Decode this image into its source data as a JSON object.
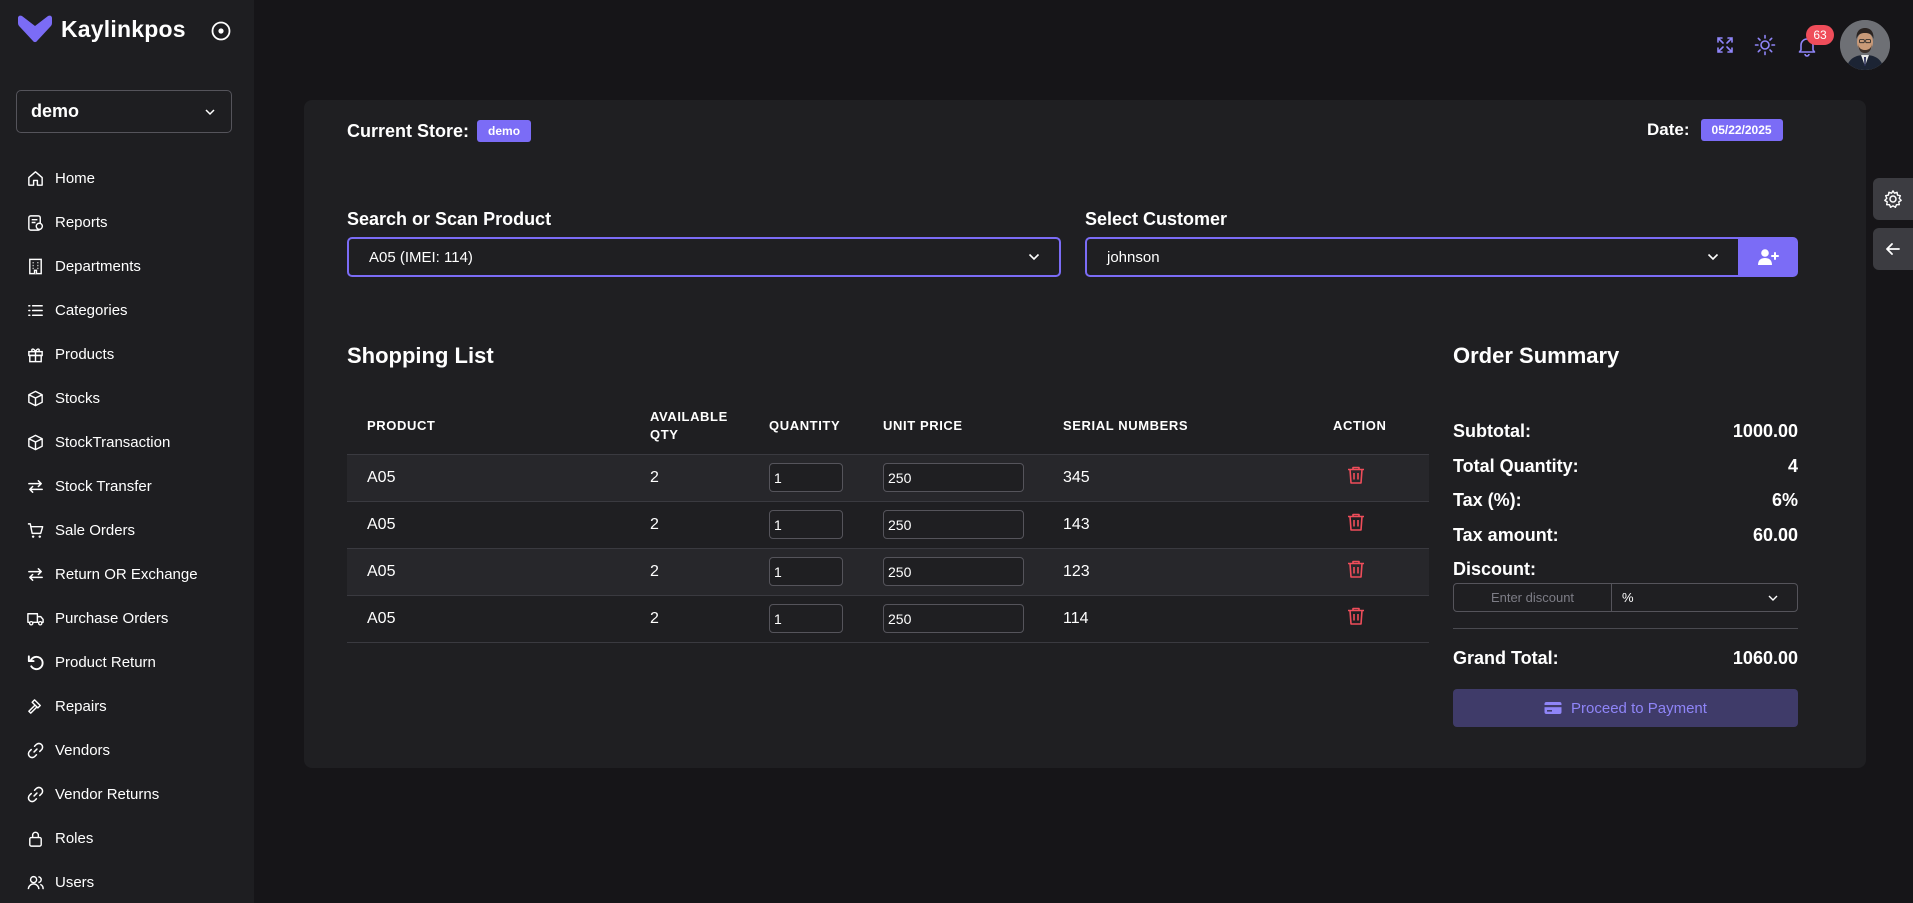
{
  "app": {
    "name": "Kaylinkpos"
  },
  "store_selector": {
    "value": "demo"
  },
  "sidebar": {
    "items": [
      {
        "label": "Home",
        "icon": "home-icon"
      },
      {
        "label": "Reports",
        "icon": "reports-icon"
      },
      {
        "label": "Departments",
        "icon": "building-icon"
      },
      {
        "label": "Categories",
        "icon": "list-icon"
      },
      {
        "label": "Products",
        "icon": "gift-icon"
      },
      {
        "label": "Stocks",
        "icon": "box-icon"
      },
      {
        "label": "StockTransaction",
        "icon": "box-icon"
      },
      {
        "label": "Stock Transfer",
        "icon": "transfer-icon"
      },
      {
        "label": "Sale Orders",
        "icon": "cart-icon"
      },
      {
        "label": "Return OR Exchange",
        "icon": "transfer-icon"
      },
      {
        "label": "Purchase Orders",
        "icon": "truck-icon"
      },
      {
        "label": "Product Return",
        "icon": "undo-icon"
      },
      {
        "label": "Repairs",
        "icon": "hammer-icon"
      },
      {
        "label": "Vendors",
        "icon": "link-icon"
      },
      {
        "label": "Vendor Returns",
        "icon": "link-icon"
      },
      {
        "label": "Roles",
        "icon": "lock-icon"
      },
      {
        "label": "Users",
        "icon": "users-icon"
      }
    ]
  },
  "header": {
    "notification_count": "63"
  },
  "pos": {
    "current_store_label": "Current Store:",
    "current_store_value": "demo",
    "date_label": "Date:",
    "date_value": "05/22/2025",
    "product_label": "Search or Scan Product",
    "product_value": "A05 (IMEI: 114)",
    "customer_label": "Select Customer",
    "customer_value": "johnson"
  },
  "shopping_list": {
    "title": "Shopping List",
    "columns": [
      "PRODUCT",
      "AVAILABLE QTY",
      "QUANTITY",
      "UNIT PRICE",
      "SERIAL NUMBERS",
      "ACTION"
    ],
    "rows": [
      {
        "product": "A05",
        "available": "2",
        "quantity": "1",
        "unit_price": "250",
        "serial": "345"
      },
      {
        "product": "A05",
        "available": "2",
        "quantity": "1",
        "unit_price": "250",
        "serial": "143"
      },
      {
        "product": "A05",
        "available": "2",
        "quantity": "1",
        "unit_price": "250",
        "serial": "123"
      },
      {
        "product": "A05",
        "available": "2",
        "quantity": "1",
        "unit_price": "250",
        "serial": "114"
      }
    ]
  },
  "summary": {
    "title": "Order Summary",
    "subtotal_label": "Subtotal:",
    "subtotal_value": "1000.00",
    "qty_label": "Total Quantity:",
    "qty_value": "4",
    "tax_label": "Tax (%):",
    "tax_value": "6%",
    "tax_amount_label": "Tax amount:",
    "tax_amount_value": "60.00",
    "discount_label": "Discount:",
    "discount_placeholder": "Enter discount",
    "discount_type": "%",
    "grand_total_label": "Grand Total:",
    "grand_total_value": "1060.00",
    "pay_button": "Proceed to Payment"
  },
  "colors": {
    "accent": "#7b6cf6",
    "danger": "#ef4d5a",
    "background": "#161518",
    "card": "#1f1f22"
  }
}
